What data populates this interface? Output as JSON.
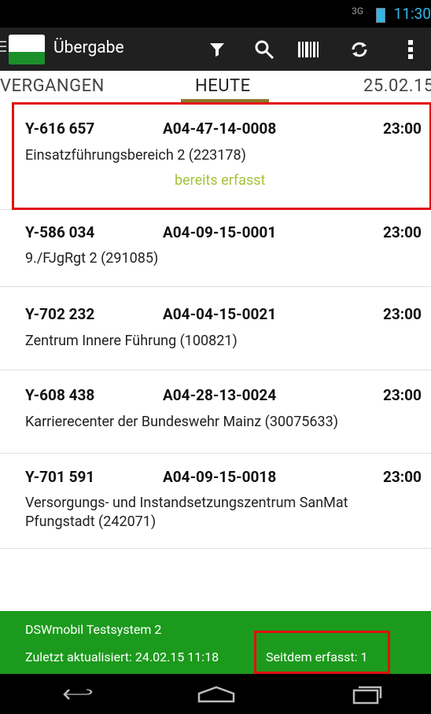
{
  "status_bar": {
    "signal": "3G",
    "time": "11:30"
  },
  "action_bar": {
    "title": "Übergabe",
    "actions": [
      "filter-icon",
      "search-icon",
      "barcode-icon",
      "refresh-icon",
      "overflow-menu-icon"
    ]
  },
  "tabs": [
    "VERGANGEN",
    "HEUTE",
    "25.02.15"
  ],
  "items": [
    {
      "code": "Y-616 657",
      "ref": "A04-47-14-0008",
      "time": "23:00",
      "desc": "Einsatzführungsbereich 2 (223178)",
      "status": "bereits erfasst"
    },
    {
      "code": "Y-586 034",
      "ref": "A04-09-15-0001",
      "time": "23:00",
      "desc": "9./FJgRgt 2 (291085)"
    },
    {
      "code": "Y-702 232",
      "ref": "A04-04-15-0021",
      "time": "23:00",
      "desc": "Zentrum Innere Führung (100821)"
    },
    {
      "code": "Y-608 438",
      "ref": "A04-28-13-0024",
      "time": "23:00",
      "desc": "Karrierecenter der Bundeswehr Mainz (30075633)"
    },
    {
      "code": "Y-701 591",
      "ref": "A04-09-15-0018",
      "time": "23:00",
      "desc": "Versorgungs- und Instandsetzungszentrum SanMat Pfungstadt (242071)"
    }
  ],
  "footer": {
    "system": "DSWmobil Testsystem 2",
    "updated": "Zuletzt aktualisiert: 24.02.15 11:18",
    "since": "Seitdem erfasst: 1"
  },
  "colors": {
    "accent": "#33b5e5",
    "footer": "#1c9a1d",
    "status_green": "#a7c23a",
    "highlight": "#e01010"
  }
}
